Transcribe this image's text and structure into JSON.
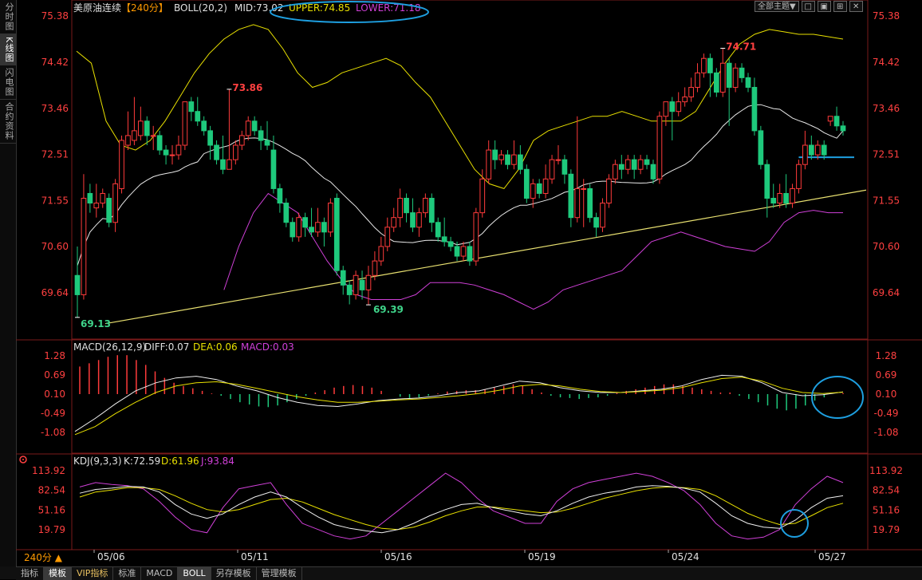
{
  "side_tabs": [
    "分时图",
    "K线图",
    "闪电图",
    "合约资料"
  ],
  "bottom_tabs": [
    "指标",
    "模板",
    "VIP指标",
    "标准",
    "MACD",
    "BOLL",
    "另存模板",
    "管理模板"
  ],
  "top_controls": {
    "theme": "全部主题▼",
    "icons": [
      "□",
      "▣",
      "⊞",
      "✕"
    ]
  },
  "main_legend": {
    "symbol": "美原油连续",
    "period": "【240分】",
    "indicator": "BOLL(20,2)",
    "mid": "MID:73.02",
    "upper": "UPPER:74.85",
    "lower": "LOWER:71.18"
  },
  "macd_legend": {
    "name": "MACD(26,12,9)",
    "diff": "DIFF:0.07",
    "dea": "DEA:0.06",
    "macd": "MACD:0.03"
  },
  "kdj_legend": {
    "name": "KDJ(9,3,3)",
    "k": "K:72.59",
    "d": "D:61.96",
    "j": "J:93.84"
  },
  "period_selector": "240分 ▲",
  "price_axis": [
    "75.38",
    "74.42",
    "73.46",
    "72.51",
    "71.55",
    "70.60",
    "69.64"
  ],
  "macd_axis": [
    "1.28",
    "0.69",
    "0.10",
    "-0.49",
    "-1.08"
  ],
  "kdj_axis": [
    "113.92",
    "82.54",
    "51.16",
    "19.79"
  ],
  "dates": [
    "05/06",
    "05/11",
    "05/16",
    "05/19",
    "05/24",
    "05/27"
  ],
  "annotations": {
    "high_1": "73.86",
    "high_2": "74.71",
    "low_1": "69.13",
    "low_2": "69.39"
  },
  "colors": {
    "up": "#ff3b3b",
    "down": "#1ec97c",
    "mid": "#e8e8e8",
    "upper": "#e8e000",
    "lower": "#d040d8",
    "axis_text": "#ff4040",
    "highlight": "#1e9fe0"
  },
  "chart_data": [
    {
      "type": "candlestick",
      "title": "美原油连续 240分",
      "ylim": [
        69.3,
        75.6
      ],
      "candles": [
        [
          70.0,
          69.6,
          70.6,
          69.13
        ],
        [
          69.6,
          71.6,
          72.1,
          69.5
        ],
        [
          71.7,
          71.5,
          71.9,
          71.3
        ],
        [
          71.4,
          71.5,
          71.9,
          71.2
        ],
        [
          71.5,
          71.7,
          71.8,
          71.4
        ],
        [
          71.6,
          71.1,
          71.7,
          71.0
        ],
        [
          71.1,
          71.9,
          72.0,
          70.9
        ],
        [
          71.8,
          72.8,
          72.9,
          71.7
        ],
        [
          72.7,
          72.9,
          73.4,
          72.6
        ],
        [
          72.8,
          73.0,
          73.7,
          72.7
        ],
        [
          72.9,
          73.2,
          73.5,
          72.8
        ],
        [
          73.2,
          72.9,
          73.3,
          72.7
        ],
        [
          72.9,
          72.9,
          73.1,
          72.6
        ],
        [
          72.9,
          72.6,
          73.0,
          72.5
        ],
        [
          72.6,
          72.5,
          72.7,
          72.3
        ],
        [
          72.5,
          72.5,
          72.7,
          72.3
        ],
        [
          72.5,
          72.7,
          72.9,
          72.4
        ],
        [
          72.7,
          73.6,
          73.6,
          72.6
        ],
        [
          73.6,
          73.4,
          73.7,
          73.2
        ],
        [
          73.4,
          73.2,
          73.7,
          73.1
        ],
        [
          73.2,
          73.0,
          73.3,
          72.9
        ],
        [
          73.0,
          72.7,
          73.1,
          72.4
        ],
        [
          72.7,
          72.4,
          72.8,
          72.3
        ],
        [
          72.4,
          72.2,
          72.9,
          72.1
        ],
        [
          72.2,
          72.4,
          73.86,
          72.2
        ],
        [
          72.4,
          72.7,
          72.8,
          72.3
        ],
        [
          72.7,
          72.9,
          73.0,
          72.6
        ],
        [
          72.9,
          73.2,
          73.3,
          72.8
        ],
        [
          73.2,
          73.0,
          73.3,
          72.9
        ],
        [
          73.0,
          72.8,
          73.1,
          72.6
        ],
        [
          72.8,
          72.7,
          73.2,
          72.6
        ],
        [
          72.6,
          71.8,
          72.9,
          71.7
        ],
        [
          71.8,
          71.5,
          71.9,
          71.3
        ],
        [
          71.5,
          71.1,
          71.6,
          71.0
        ],
        [
          71.1,
          70.8,
          71.2,
          70.7
        ],
        [
          70.8,
          71.2,
          71.3,
          70.7
        ],
        [
          71.2,
          71.0,
          71.3,
          70.8
        ],
        [
          71.0,
          70.9,
          71.4,
          70.8
        ],
        [
          70.9,
          71.1,
          71.4,
          70.8
        ],
        [
          71.1,
          70.9,
          71.2,
          70.6
        ],
        [
          70.9,
          71.5,
          71.6,
          70.8
        ],
        [
          71.6,
          70.1,
          71.7,
          70.0
        ],
        [
          70.1,
          69.8,
          70.2,
          69.6
        ],
        [
          69.8,
          69.6,
          69.9,
          69.4
        ],
        [
          69.6,
          70.0,
          70.1,
          69.5
        ],
        [
          69.9,
          69.7,
          70.1,
          69.5
        ],
        [
          69.7,
          70.0,
          70.2,
          69.39
        ],
        [
          70.0,
          70.3,
          70.5,
          69.9
        ],
        [
          70.3,
          70.6,
          70.8,
          70.2
        ],
        [
          70.6,
          71.0,
          71.2,
          70.5
        ],
        [
          71.0,
          71.2,
          71.4,
          70.9
        ],
        [
          71.2,
          71.6,
          71.8,
          71.0
        ],
        [
          71.6,
          71.3,
          71.7,
          71.1
        ],
        [
          71.3,
          71.0,
          71.6,
          70.9
        ],
        [
          71.0,
          71.3,
          71.4,
          70.8
        ],
        [
          71.3,
          71.6,
          71.7,
          71.2
        ],
        [
          71.6,
          71.1,
          71.7,
          70.9
        ],
        [
          71.1,
          70.8,
          71.2,
          70.7
        ],
        [
          70.8,
          70.7,
          71.2,
          70.6
        ],
        [
          70.7,
          70.6,
          70.8,
          70.5
        ],
        [
          70.6,
          70.4,
          70.7,
          70.3
        ],
        [
          70.4,
          70.6,
          70.7,
          70.3
        ],
        [
          70.6,
          70.3,
          70.7,
          70.2
        ],
        [
          70.3,
          71.3,
          71.4,
          70.2
        ],
        [
          71.3,
          72.0,
          72.2,
          71.2
        ],
        [
          72.0,
          72.6,
          72.8,
          71.9
        ],
        [
          72.6,
          72.4,
          72.8,
          72.2
        ],
        [
          72.4,
          72.5,
          72.6,
          72.3
        ],
        [
          72.5,
          72.3,
          72.6,
          72.2
        ],
        [
          72.3,
          72.5,
          72.8,
          72.2
        ],
        [
          72.5,
          72.2,
          72.7,
          72.1
        ],
        [
          72.2,
          71.6,
          72.3,
          71.5
        ],
        [
          71.6,
          71.9,
          72.0,
          71.4
        ],
        [
          71.9,
          71.7,
          72.0,
          71.6
        ],
        [
          71.7,
          72.0,
          72.3,
          71.6
        ],
        [
          72.0,
          72.4,
          72.5,
          71.9
        ],
        [
          72.4,
          72.4,
          72.7,
          72.3
        ],
        [
          72.4,
          72.1,
          72.5,
          71.9
        ],
        [
          72.1,
          71.2,
          72.2,
          71.0
        ],
        [
          71.2,
          71.8,
          73.3,
          71.1
        ],
        [
          71.8,
          71.8,
          72.0,
          71.0
        ],
        [
          71.8,
          71.2,
          71.9,
          71.1
        ],
        [
          71.2,
          71.0,
          71.3,
          70.8
        ],
        [
          71.0,
          71.5,
          71.6,
          70.9
        ],
        [
          71.5,
          72.0,
          72.1,
          71.4
        ],
        [
          72.0,
          72.3,
          72.4,
          71.9
        ],
        [
          72.3,
          72.2,
          72.5,
          72.0
        ],
        [
          72.2,
          72.4,
          72.5,
          72.1
        ],
        [
          72.4,
          72.2,
          72.5,
          72.0
        ],
        [
          72.2,
          72.4,
          72.5,
          72.1
        ],
        [
          72.4,
          72.3,
          72.5,
          72.2
        ],
        [
          72.3,
          72.0,
          72.4,
          71.9
        ],
        [
          72.0,
          73.3,
          73.4,
          71.9
        ],
        [
          73.3,
          73.6,
          73.6,
          73.1
        ],
        [
          73.6,
          73.4,
          73.7,
          72.8
        ],
        [
          73.4,
          73.6,
          73.8,
          73.3
        ],
        [
          73.6,
          73.7,
          73.9,
          73.5
        ],
        [
          73.7,
          73.9,
          74.1,
          73.6
        ],
        [
          73.9,
          74.2,
          74.4,
          73.8
        ],
        [
          74.2,
          74.5,
          74.6,
          74.1
        ],
        [
          74.5,
          74.2,
          74.6,
          73.7
        ],
        [
          74.2,
          73.8,
          74.3,
          73.7
        ],
        [
          73.8,
          74.4,
          74.71,
          73.7
        ],
        [
          74.4,
          73.9,
          74.5,
          73.1
        ],
        [
          73.9,
          74.3,
          74.4,
          73.8
        ],
        [
          74.3,
          74.1,
          74.4,
          74.0
        ],
        [
          74.1,
          73.9,
          74.2,
          73.8
        ],
        [
          73.9,
          73.0,
          74.1,
          72.9
        ],
        [
          73.0,
          72.3,
          73.1,
          72.2
        ],
        [
          72.3,
          71.6,
          72.4,
          71.2
        ],
        [
          71.6,
          71.5,
          71.9,
          71.4
        ],
        [
          71.5,
          71.7,
          71.9,
          71.4
        ],
        [
          71.7,
          71.5,
          72.1,
          71.4
        ],
        [
          71.5,
          71.8,
          71.9,
          71.4
        ],
        [
          71.8,
          72.3,
          72.4,
          71.7
        ],
        [
          72.3,
          72.7,
          73.0,
          72.2
        ],
        [
          72.7,
          72.5,
          72.9,
          72.4
        ],
        [
          72.5,
          72.7,
          72.8,
          72.4
        ],
        [
          72.7,
          72.5,
          72.8,
          72.4
        ],
        [
          73.2,
          73.3,
          73.3,
          73.1
        ],
        [
          73.3,
          73.1,
          73.5,
          73.0
        ],
        [
          73.1,
          73.0,
          73.2,
          72.9
        ]
      ],
      "boll": {
        "mid_start": 70.2,
        "mid_end": 73.0,
        "upper": [
          74.65,
          74.4,
          73.2,
          72.7,
          72.6,
          72.8,
          73.2,
          73.7,
          74.2,
          74.6,
          74.9,
          75.1,
          75.2,
          75.1,
          74.7,
          74.2,
          73.9,
          74.0,
          74.2,
          74.3,
          74.4,
          74.5,
          74.35,
          74.0,
          73.7,
          73.2,
          72.7,
          72.2,
          71.9,
          71.8,
          72.2,
          72.8,
          73.0,
          73.1,
          73.2,
          73.3,
          73.3,
          73.4,
          73.3,
          73.2,
          73.2,
          73.2,
          73.4,
          73.9,
          74.4,
          74.8,
          75.0,
          75.1,
          75.05,
          75.0,
          75.0,
          74.95,
          74.9
        ],
        "lower": [
          null,
          null,
          null,
          null,
          null,
          null,
          null,
          null,
          null,
          null,
          69.7,
          70.6,
          71.3,
          71.7,
          71.5,
          71.3,
          70.8,
          70.3,
          69.9,
          69.6,
          69.5,
          69.5,
          69.5,
          69.6,
          69.85,
          69.85,
          69.85,
          69.8,
          69.7,
          69.6,
          69.45,
          69.3,
          69.45,
          69.7,
          69.8,
          69.9,
          70.0,
          70.1,
          70.4,
          70.7,
          70.8,
          70.9,
          70.8,
          70.7,
          70.6,
          70.55,
          70.5,
          70.7,
          71.1,
          71.3,
          71.35,
          71.3,
          71.3
        ],
        "upper_label": "UPPER",
        "lower_label": "LOWER",
        "mid_label": "MID"
      },
      "trendline": {
        "x": [
          0,
          122
        ],
        "y": [
          69.0,
          71.77
        ]
      },
      "marker_line": {
        "x": [
          114,
          121
        ],
        "price": 72.45
      }
    },
    {
      "type": "bar",
      "title": "MACD(26,12,9)",
      "ylim": [
        -1.2,
        1.4
      ],
      "diff": [
        -1.15,
        -0.75,
        -0.3,
        0.1,
        0.35,
        0.5,
        0.55,
        0.45,
        0.25,
        0.1,
        -0.1,
        -0.25,
        -0.35,
        -0.38,
        -0.3,
        -0.2,
        -0.15,
        -0.12,
        -0.05,
        0.05,
        0.1,
        0.25,
        0.4,
        0.35,
        0.2,
        0.1,
        0.05,
        0.05,
        0.1,
        0.15,
        0.25,
        0.45,
        0.58,
        0.55,
        0.35,
        0.05,
        -0.05,
        -0.02,
        0.07
      ],
      "dea": [
        -1.25,
        -1.0,
        -0.6,
        -0.25,
        0.05,
        0.25,
        0.35,
        0.38,
        0.3,
        0.18,
        0.05,
        -0.08,
        -0.18,
        -0.25,
        -0.25,
        -0.22,
        -0.18,
        -0.15,
        -0.1,
        -0.05,
        0.02,
        0.12,
        0.25,
        0.3,
        0.25,
        0.15,
        0.08,
        0.05,
        0.08,
        0.12,
        0.2,
        0.35,
        0.48,
        0.52,
        0.4,
        0.18,
        0.05,
        0.02,
        0.06
      ],
      "hist": [
        0.85,
        0.95,
        1.05,
        1.15,
        1.2,
        1.2,
        1.05,
        0.9,
        0.7,
        0.5,
        0.35,
        0.25,
        0.18,
        0.1,
        0.02,
        -0.05,
        -0.15,
        -0.25,
        -0.32,
        -0.38,
        -0.4,
        -0.35,
        -0.25,
        -0.15,
        -0.05,
        0.05,
        0.12,
        0.2,
        0.25,
        0.28,
        0.25,
        0.2,
        0.1,
        0.0,
        -0.08,
        -0.12,
        -0.1,
        -0.05,
        0.02,
        0.08,
        0.1,
        0.12,
        0.12,
        0.15,
        0.2,
        0.25,
        0.3,
        0.25,
        0.15,
        0.05,
        -0.05,
        -0.1,
        -0.12,
        -0.15,
        -0.12,
        -0.1,
        -0.05,
        0.03,
        0.1,
        0.15,
        0.2,
        0.25,
        0.3,
        0.3,
        0.25,
        0.2,
        0.15,
        0.1,
        0.05,
        0.05,
        -0.05,
        -0.15,
        -0.25,
        -0.35,
        -0.45,
        -0.5,
        -0.45,
        -0.35,
        -0.2,
        -0.1,
        0.0,
        0.03
      ]
    },
    {
      "type": "line",
      "title": "KDJ(9,3,3)",
      "ylim": [
        0,
        120
      ],
      "k": [
        78,
        84,
        86,
        89,
        88,
        80,
        60,
        45,
        38,
        45,
        60,
        72,
        80,
        72,
        55,
        40,
        28,
        22,
        18,
        15,
        20,
        30,
        42,
        52,
        60,
        62,
        55,
        50,
        45,
        42,
        50,
        62,
        72,
        78,
        82,
        88,
        90,
        89,
        86,
        80,
        62,
        42,
        30,
        24,
        22,
        35,
        55,
        70,
        74
      ],
      "d": [
        72,
        80,
        83,
        87,
        87,
        84,
        74,
        62,
        52,
        48,
        52,
        60,
        68,
        70,
        64,
        54,
        44,
        36,
        28,
        22,
        20,
        24,
        32,
        42,
        50,
        56,
        56,
        53,
        50,
        47,
        48,
        54,
        62,
        70,
        76,
        82,
        86,
        88,
        87,
        84,
        74,
        60,
        46,
        36,
        28,
        30,
        42,
        55,
        62
      ],
      "j": [
        88,
        95,
        92,
        90,
        85,
        65,
        40,
        20,
        15,
        55,
        85,
        90,
        95,
        60,
        30,
        20,
        10,
        5,
        10,
        30,
        50,
        70,
        90,
        110,
        95,
        70,
        50,
        40,
        30,
        30,
        65,
        85,
        95,
        100,
        105,
        110,
        105,
        95,
        82,
        60,
        30,
        10,
        5,
        8,
        20,
        60,
        85,
        105,
        95
      ]
    }
  ]
}
